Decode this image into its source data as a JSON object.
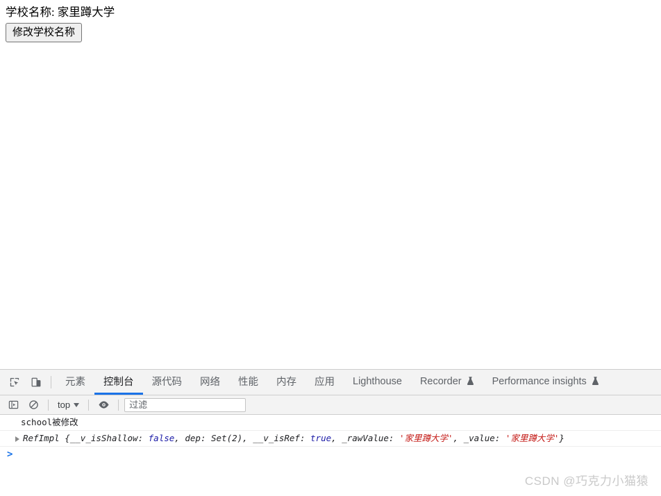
{
  "page": {
    "school_label": "学校名称: 家里蹲大学",
    "change_button": "修改学校名称"
  },
  "devtools": {
    "left_icons": [
      {
        "name": "inspect-element-icon",
        "glyph": "inspect"
      },
      {
        "name": "device-toolbar-icon",
        "glyph": "device"
      }
    ],
    "tabs": [
      {
        "label": "元素",
        "active": false,
        "experimental": false
      },
      {
        "label": "控制台",
        "active": true,
        "experimental": false
      },
      {
        "label": "源代码",
        "active": false,
        "experimental": false
      },
      {
        "label": "网络",
        "active": false,
        "experimental": false
      },
      {
        "label": "性能",
        "active": false,
        "experimental": false
      },
      {
        "label": "内存",
        "active": false,
        "experimental": false
      },
      {
        "label": "应用",
        "active": false,
        "experimental": false
      },
      {
        "label": "Lighthouse",
        "active": false,
        "experimental": false
      },
      {
        "label": "Recorder",
        "active": false,
        "experimental": true
      },
      {
        "label": "Performance insights",
        "active": false,
        "experimental": true
      }
    ],
    "console_toolbar": {
      "sidebar_toggle_icon": "console-sidebar-icon",
      "clear_console_icon": "clear-console-icon",
      "context_value": "top",
      "live_expression_icon": "eye-icon",
      "filter_placeholder": "过滤",
      "filter_value": ""
    },
    "console_messages": [
      {
        "type": "log",
        "text": "school被修改"
      },
      {
        "type": "object",
        "expanded": false,
        "constructor": "RefImpl",
        "open_brace": "{",
        "close_brace": "}",
        "properties": [
          {
            "key": "__v_isShallow",
            "value": "false",
            "kind": "bool",
            "trailing": ", "
          },
          {
            "key": "dep",
            "value": "Set(2)",
            "kind": "plain",
            "trailing": ", "
          },
          {
            "key": "__v_isRef",
            "value": "true",
            "kind": "bool",
            "trailing": ", "
          },
          {
            "key": "_rawValue",
            "value": "'家里蹲大学'",
            "kind": "string",
            "trailing": ", "
          },
          {
            "key": "_value",
            "value": "'家里蹲大学'",
            "kind": "string",
            "trailing": ""
          }
        ]
      }
    ],
    "prompt_chevron": ">",
    "accent_color": "#1a73e8",
    "string_color": "#c41a16",
    "bool_color": "#1a1aa6"
  },
  "watermark": {
    "text": "CSDN @巧克力小猫猿"
  }
}
